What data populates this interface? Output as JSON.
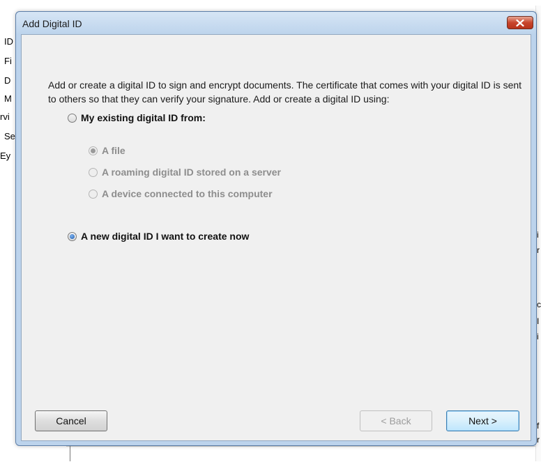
{
  "background": {
    "left_fragments": [
      "ID",
      "Fi",
      "D",
      "M",
      "rvi",
      "Se",
      "Ey"
    ],
    "right_fragments": [
      "i",
      "r",
      "c",
      "I",
      "i",
      "f",
      "r"
    ]
  },
  "dialog": {
    "title": "Add Digital ID",
    "description": "Add or create a digital ID to sign and encrypt documents. The certificate that comes with your digital ID is sent to others so that they can verify your signature. Add or create a digital ID using:",
    "options": {
      "existing": {
        "label": "My existing digital ID from:",
        "selected": false,
        "enabled": true
      },
      "file": {
        "label": "A file",
        "selected": true,
        "enabled": false
      },
      "roaming": {
        "label": "A roaming digital ID stored on a server",
        "selected": false,
        "enabled": false
      },
      "device": {
        "label": "A device connected to this computer",
        "selected": false,
        "enabled": false
      },
      "new": {
        "label": "A new digital ID I want to create now",
        "selected": true,
        "enabled": true
      }
    },
    "buttons": {
      "cancel": "Cancel",
      "back": "< Back",
      "next": "Next >"
    }
  }
}
